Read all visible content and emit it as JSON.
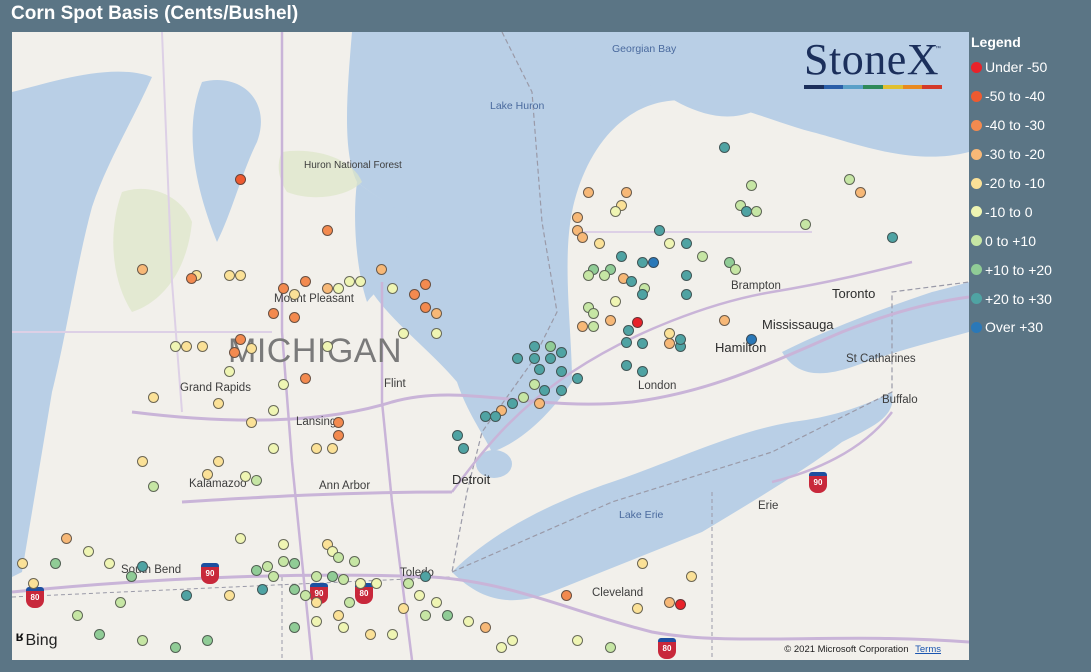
{
  "title": "Corn Spot Basis (Cents/Bushel)",
  "legend": {
    "title": "Legend",
    "items": [
      {
        "label": "Under -50",
        "color": "#e8222a"
      },
      {
        "label": "-50 to -40",
        "color": "#ee5a30"
      },
      {
        "label": "-40 to -30",
        "color": "#f38a4f"
      },
      {
        "label": "-30 to -20",
        "color": "#f7b877"
      },
      {
        "label": "-20 to -10",
        "color": "#fbe197"
      },
      {
        "label": "-10 to 0",
        "color": "#eff5b3"
      },
      {
        "label": "0 to +10",
        "color": "#c6e6a4"
      },
      {
        "label": "+10 to +20",
        "color": "#90cc96"
      },
      {
        "label": "+20 to +30",
        "color": "#4fa3a3"
      },
      {
        "label": "Over +30",
        "color": "#2a78b8"
      }
    ]
  },
  "logo": {
    "text": "StoneX",
    "tm": "™",
    "stripe_colors": [
      "#1b2f5b",
      "#2a5ea8",
      "#5aa0c8",
      "#2e8a5a",
      "#e0c030",
      "#e88a20",
      "#d43a2a"
    ]
  },
  "map": {
    "labels": {
      "state": "MICHIGAN",
      "lake_huron": "Lake Huron",
      "georgian_bay": "Georgian Bay",
      "lake_erie": "Lake Erie",
      "huron_forest": "Huron National Forest",
      "mount_pleasant": "Mount Pleasant",
      "grand_rapids": "Grand Rapids",
      "flint": "Flint",
      "lansing": "Lansing",
      "kalamazoo": "Kalamazoo",
      "ann_arbor": "Ann Arbor",
      "detroit": "Detroit",
      "toledo": "Toledo",
      "south_bend": "South Bend",
      "cleveland": "Cleveland",
      "erie": "Erie",
      "buffalo": "Buffalo",
      "st_catharines": "St Catharines",
      "hamilton": "Hamilton",
      "mississauga": "Mississauga",
      "toronto": "Toronto",
      "brampton": "Brampton",
      "london": "London"
    },
    "shields": [
      "80",
      "90",
      "90",
      "80",
      "80",
      "90",
      "80"
    ],
    "points": [
      {
        "lat": 44.7,
        "lon": -85.0,
        "basis": -45
      },
      {
        "lat": 44.3,
        "lon": -84.2,
        "basis": -35
      },
      {
        "lat": 44.0,
        "lon": -83.7,
        "basis": -25
      },
      {
        "lat": 44.0,
        "lon": -85.9,
        "basis": -25
      },
      {
        "lat": 43.95,
        "lon": -85.1,
        "basis": -20
      },
      {
        "lat": 43.95,
        "lon": -85.4,
        "basis": -20
      },
      {
        "lat": 43.95,
        "lon": -85.0,
        "basis": -20
      },
      {
        "lat": 43.93,
        "lon": -85.45,
        "basis": -35
      },
      {
        "lat": 43.9,
        "lon": -84.4,
        "basis": -35
      },
      {
        "lat": 43.85,
        "lon": -84.6,
        "basis": -35
      },
      {
        "lat": 43.85,
        "lon": -84.2,
        "basis": -25
      },
      {
        "lat": 43.8,
        "lon": -84.5,
        "basis": -20
      },
      {
        "lat": 43.85,
        "lon": -84.1,
        "basis": -10
      },
      {
        "lat": 43.9,
        "lon": -84.0,
        "basis": -10
      },
      {
        "lat": 43.9,
        "lon": -83.9,
        "basis": -10
      },
      {
        "lat": 43.85,
        "lon": -83.6,
        "basis": -10
      },
      {
        "lat": 43.88,
        "lon": -83.3,
        "basis": -35
      },
      {
        "lat": 43.8,
        "lon": -83.4,
        "basis": -35
      },
      {
        "lat": 43.7,
        "lon": -83.3,
        "basis": -35
      },
      {
        "lat": 43.65,
        "lon": -83.2,
        "basis": -25
      },
      {
        "lat": 43.65,
        "lon": -84.7,
        "basis": -35
      },
      {
        "lat": 43.62,
        "lon": -84.5,
        "basis": -35
      },
      {
        "lat": 43.5,
        "lon": -83.5,
        "basis": -10
      },
      {
        "lat": 43.5,
        "lon": -83.2,
        "basis": -10
      },
      {
        "lat": 43.45,
        "lon": -85.0,
        "basis": -35
      },
      {
        "lat": 43.4,
        "lon": -85.6,
        "basis": -10
      },
      {
        "lat": 43.4,
        "lon": -85.5,
        "basis": -20
      },
      {
        "lat": 43.4,
        "lon": -85.35,
        "basis": -20
      },
      {
        "lat": 43.38,
        "lon": -84.9,
        "basis": -20
      },
      {
        "lat": 43.35,
        "lon": -85.05,
        "basis": -40
      },
      {
        "lat": 43.4,
        "lon": -84.2,
        "basis": -10
      },
      {
        "lat": 43.2,
        "lon": -85.1,
        "basis": -10
      },
      {
        "lat": 43.1,
        "lon": -84.6,
        "basis": -10
      },
      {
        "lat": 43.15,
        "lon": -84.4,
        "basis": -35
      },
      {
        "lat": 43.0,
        "lon": -85.8,
        "basis": -20
      },
      {
        "lat": 42.95,
        "lon": -85.2,
        "basis": -20
      },
      {
        "lat": 42.9,
        "lon": -84.7,
        "basis": -10
      },
      {
        "lat": 42.8,
        "lon": -84.9,
        "basis": -20
      },
      {
        "lat": 42.8,
        "lon": -84.1,
        "basis": -35
      },
      {
        "lat": 42.7,
        "lon": -84.1,
        "basis": -35
      },
      {
        "lat": 42.6,
        "lon": -84.3,
        "basis": -20
      },
      {
        "lat": 42.6,
        "lon": -84.7,
        "basis": -10
      },
      {
        "lat": 42.6,
        "lon": -84.15,
        "basis": -20
      },
      {
        "lat": 42.5,
        "lon": -85.9,
        "basis": -20
      },
      {
        "lat": 42.5,
        "lon": -85.2,
        "basis": -20
      },
      {
        "lat": 42.4,
        "lon": -85.3,
        "basis": -20
      },
      {
        "lat": 42.38,
        "lon": -84.95,
        "basis": -10
      },
      {
        "lat": 42.35,
        "lon": -84.85,
        "basis": 5
      },
      {
        "lat": 42.3,
        "lon": -85.8,
        "basis": 5
      },
      {
        "lat": 44.6,
        "lon": -81.8,
        "basis": -25
      },
      {
        "lat": 44.6,
        "lon": -81.45,
        "basis": -25
      },
      {
        "lat": 44.5,
        "lon": -81.5,
        "basis": -20
      },
      {
        "lat": 44.45,
        "lon": -81.55,
        "basis": -10
      },
      {
        "lat": 44.4,
        "lon": -81.9,
        "basis": -25
      },
      {
        "lat": 44.3,
        "lon": -81.9,
        "basis": -25
      },
      {
        "lat": 44.25,
        "lon": -81.85,
        "basis": -25
      },
      {
        "lat": 44.2,
        "lon": -81.7,
        "basis": -20
      },
      {
        "lat": 44.3,
        "lon": -81.15,
        "basis": 25
      },
      {
        "lat": 44.2,
        "lon": -81.05,
        "basis": -10
      },
      {
        "lat": 44.1,
        "lon": -81.5,
        "basis": 25
      },
      {
        "lat": 44.05,
        "lon": -81.3,
        "basis": 25
      },
      {
        "lat": 44.05,
        "lon": -81.2,
        "basis": 35
      },
      {
        "lat": 44.0,
        "lon": -81.6,
        "basis": 15
      },
      {
        "lat": 44.0,
        "lon": -81.75,
        "basis": 15
      },
      {
        "lat": 43.95,
        "lon": -81.8,
        "basis": 5
      },
      {
        "lat": 43.95,
        "lon": -81.65,
        "basis": 5
      },
      {
        "lat": 43.93,
        "lon": -81.48,
        "basis": -25
      },
      {
        "lat": 43.9,
        "lon": -81.4,
        "basis": 25
      },
      {
        "lat": 43.85,
        "lon": -81.28,
        "basis": 5
      },
      {
        "lat": 43.8,
        "lon": -81.3,
        "basis": 25
      },
      {
        "lat": 43.75,
        "lon": -81.55,
        "basis": -5
      },
      {
        "lat": 43.7,
        "lon": -81.8,
        "basis": 5
      },
      {
        "lat": 43.65,
        "lon": -81.75,
        "basis": 5
      },
      {
        "lat": 43.6,
        "lon": -81.6,
        "basis": -25
      },
      {
        "lat": 43.58,
        "lon": -81.35,
        "basis": -55
      },
      {
        "lat": 43.55,
        "lon": -81.85,
        "basis": -25
      },
      {
        "lat": 43.55,
        "lon": -81.75,
        "basis": 5
      },
      {
        "lat": 43.52,
        "lon": -81.43,
        "basis": 25
      },
      {
        "lat": 43.43,
        "lon": -81.45,
        "basis": 25
      },
      {
        "lat": 43.42,
        "lon": -81.3,
        "basis": 25
      },
      {
        "lat": 43.4,
        "lon": -80.95,
        "basis": 25
      },
      {
        "lat": 43.42,
        "lon": -81.05,
        "basis": -25
      },
      {
        "lat": 43.4,
        "lon": -82.3,
        "basis": 25
      },
      {
        "lat": 43.4,
        "lon": -82.15,
        "basis": 15
      },
      {
        "lat": 43.35,
        "lon": -82.05,
        "basis": 25
      },
      {
        "lat": 43.3,
        "lon": -82.45,
        "basis": 25
      },
      {
        "lat": 43.3,
        "lon": -82.3,
        "basis": 25
      },
      {
        "lat": 43.3,
        "lon": -82.15,
        "basis": 25
      },
      {
        "lat": 43.22,
        "lon": -82.25,
        "basis": 25
      },
      {
        "lat": 43.2,
        "lon": -82.05,
        "basis": 25
      },
      {
        "lat": 43.25,
        "lon": -81.45,
        "basis": 25
      },
      {
        "lat": 43.2,
        "lon": -81.3,
        "basis": 25
      },
      {
        "lat": 43.15,
        "lon": -81.9,
        "basis": 25
      },
      {
        "lat": 43.1,
        "lon": -82.3,
        "basis": 5
      },
      {
        "lat": 43.05,
        "lon": -82.2,
        "basis": 25
      },
      {
        "lat": 43.05,
        "lon": -82.05,
        "basis": 25
      },
      {
        "lat": 43.0,
        "lon": -82.4,
        "basis": 5
      },
      {
        "lat": 42.95,
        "lon": -82.5,
        "basis": 25
      },
      {
        "lat": 42.95,
        "lon": -82.25,
        "basis": -25
      },
      {
        "lat": 42.9,
        "lon": -82.6,
        "basis": -25
      },
      {
        "lat": 42.85,
        "lon": -82.75,
        "basis": 25
      },
      {
        "lat": 42.85,
        "lon": -82.65,
        "basis": 25
      },
      {
        "lat": 42.7,
        "lon": -83.0,
        "basis": 25
      },
      {
        "lat": 42.6,
        "lon": -82.95,
        "basis": 25
      },
      {
        "lat": 44.95,
        "lon": -80.55,
        "basis": 25
      },
      {
        "lat": 44.65,
        "lon": -80.3,
        "basis": 5
      },
      {
        "lat": 44.5,
        "lon": -80.4,
        "basis": 5
      },
      {
        "lat": 44.45,
        "lon": -80.35,
        "basis": 25
      },
      {
        "lat": 44.45,
        "lon": -80.25,
        "basis": 5
      },
      {
        "lat": 44.35,
        "lon": -79.8,
        "basis": 5
      },
      {
        "lat": 44.7,
        "lon": -79.4,
        "basis": 5
      },
      {
        "lat": 44.6,
        "lon": -79.3,
        "basis": -25
      },
      {
        "lat": 44.25,
        "lon": -79.0,
        "basis": 25
      },
      {
        "lat": 44.2,
        "lon": -80.9,
        "basis": 25
      },
      {
        "lat": 44.1,
        "lon": -80.75,
        "basis": 5
      },
      {
        "lat": 44.05,
        "lon": -80.5,
        "basis": 15
      },
      {
        "lat": 44.0,
        "lon": -80.45,
        "basis": 5
      },
      {
        "lat": 43.95,
        "lon": -80.9,
        "basis": 25
      },
      {
        "lat": 43.8,
        "lon": -80.9,
        "basis": 25
      },
      {
        "lat": 43.6,
        "lon": -80.55,
        "basis": -25
      },
      {
        "lat": 43.5,
        "lon": -81.05,
        "basis": -20
      },
      {
        "lat": 43.45,
        "lon": -80.95,
        "basis": 25
      },
      {
        "lat": 43.45,
        "lon": -80.3,
        "basis": 35
      },
      {
        "lat": 41.9,
        "lon": -86.6,
        "basis": -25
      },
      {
        "lat": 41.8,
        "lon": -86.4,
        "basis": -10
      },
      {
        "lat": 41.7,
        "lon": -86.7,
        "basis": 15
      },
      {
        "lat": 41.7,
        "lon": -86.2,
        "basis": -10
      },
      {
        "lat": 41.68,
        "lon": -85.9,
        "basis": 25
      },
      {
        "lat": 41.6,
        "lon": -86.0,
        "basis": 15
      },
      {
        "lat": 41.9,
        "lon": -85.0,
        "basis": -10
      },
      {
        "lat": 41.85,
        "lon": -84.6,
        "basis": -10
      },
      {
        "lat": 41.85,
        "lon": -84.2,
        "basis": -20
      },
      {
        "lat": 41.8,
        "lon": -84.15,
        "basis": -10
      },
      {
        "lat": 41.75,
        "lon": -84.1,
        "basis": 5
      },
      {
        "lat": 41.72,
        "lon": -83.95,
        "basis": 5
      },
      {
        "lat": 41.7,
        "lon": -84.5,
        "basis": 15
      },
      {
        "lat": 41.72,
        "lon": -84.6,
        "basis": 5
      },
      {
        "lat": 41.68,
        "lon": -84.75,
        "basis": 5
      },
      {
        "lat": 41.65,
        "lon": -84.85,
        "basis": 15
      },
      {
        "lat": 41.6,
        "lon": -84.7,
        "basis": 5
      },
      {
        "lat": 41.6,
        "lon": -84.3,
        "basis": 5
      },
      {
        "lat": 41.6,
        "lon": -84.15,
        "basis": 15
      },
      {
        "lat": 41.58,
        "lon": -84.05,
        "basis": 5
      },
      {
        "lat": 41.55,
        "lon": -83.9,
        "basis": -10
      },
      {
        "lat": 41.55,
        "lon": -83.75,
        "basis": -10
      },
      {
        "lat": 41.5,
        "lon": -84.8,
        "basis": 25
      },
      {
        "lat": 41.5,
        "lon": -84.5,
        "basis": 15
      },
      {
        "lat": 41.45,
        "lon": -84.4,
        "basis": 5
      },
      {
        "lat": 41.4,
        "lon": -84.3,
        "basis": -20
      },
      {
        "lat": 41.4,
        "lon": -84.0,
        "basis": 5
      },
      {
        "lat": 41.35,
        "lon": -83.5,
        "basis": -20
      },
      {
        "lat": 41.3,
        "lon": -83.1,
        "basis": 15
      },
      {
        "lat": 41.3,
        "lon": -84.1,
        "basis": -20
      },
      {
        "lat": 41.25,
        "lon": -84.3,
        "basis": -10
      },
      {
        "lat": 41.2,
        "lon": -84.5,
        "basis": 15
      },
      {
        "lat": 41.2,
        "lon": -84.05,
        "basis": -10
      },
      {
        "lat": 41.15,
        "lon": -83.8,
        "basis": -20
      },
      {
        "lat": 41.15,
        "lon": -83.6,
        "basis": -10
      },
      {
        "lat": 41.1,
        "lon": -85.3,
        "basis": 15
      },
      {
        "lat": 41.05,
        "lon": -85.6,
        "basis": 15
      },
      {
        "lat": 41.45,
        "lon": -85.1,
        "basis": -20
      },
      {
        "lat": 41.45,
        "lon": -85.5,
        "basis": 25
      },
      {
        "lat": 41.4,
        "lon": -86.1,
        "basis": 5
      },
      {
        "lat": 41.7,
        "lon": -87.0,
        "basis": -20
      },
      {
        "lat": 41.55,
        "lon": -86.9,
        "basis": -20
      },
      {
        "lat": 41.3,
        "lon": -86.5,
        "basis": 5
      },
      {
        "lat": 41.15,
        "lon": -86.3,
        "basis": 15
      },
      {
        "lat": 41.1,
        "lon": -85.9,
        "basis": 5
      },
      {
        "lat": 41.3,
        "lon": -83.3,
        "basis": 5
      },
      {
        "lat": 41.6,
        "lon": -83.3,
        "basis": 25
      },
      {
        "lat": 41.55,
        "lon": -83.45,
        "basis": 5
      },
      {
        "lat": 41.45,
        "lon": -83.35,
        "basis": -10
      },
      {
        "lat": 41.4,
        "lon": -83.2,
        "basis": -10
      },
      {
        "lat": 41.25,
        "lon": -82.9,
        "basis": -10
      },
      {
        "lat": 41.2,
        "lon": -82.75,
        "basis": -25
      },
      {
        "lat": 41.1,
        "lon": -82.5,
        "basis": -10
      },
      {
        "lat": 41.05,
        "lon": -82.6,
        "basis": -10
      },
      {
        "lat": 41.45,
        "lon": -82.0,
        "basis": -35
      },
      {
        "lat": 41.35,
        "lon": -81.35,
        "basis": -20
      },
      {
        "lat": 41.4,
        "lon": -81.05,
        "basis": -30
      },
      {
        "lat": 41.38,
        "lon": -80.95,
        "basis": -55
      },
      {
        "lat": 41.6,
        "lon": -80.85,
        "basis": -20
      },
      {
        "lat": 41.7,
        "lon": -81.3,
        "basis": -20
      },
      {
        "lat": 41.05,
        "lon": -81.6,
        "basis": 5
      },
      {
        "lat": 41.1,
        "lon": -81.9,
        "basis": -10
      }
    ]
  }
}
